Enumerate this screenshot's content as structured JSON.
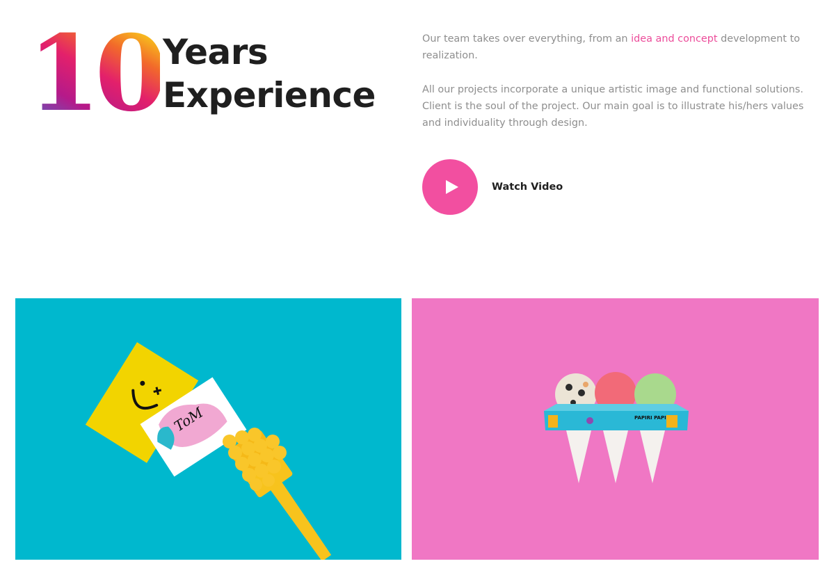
{
  "hero": {
    "number": "10",
    "title_line1": "Years",
    "title_line2": "Experience"
  },
  "intro": {
    "p1_before": "Our team takes over everything, from an ",
    "p1_highlight": "idea and concept",
    "p1_after": " development to realization.",
    "p2": "All our projects incorporate a unique artistic image and functional solutions. Client is the soul of the project. Our main goal is to illustrate his/hers values and individuality through design."
  },
  "video": {
    "label": "Watch Video",
    "icon": "play-icon"
  },
  "portfolio": {
    "tile1_label": "ToM",
    "tile2_label": "PAPIRI PAPIRI"
  },
  "colors": {
    "accent": "#f24fa0",
    "tile1_bg": "#00b8ce",
    "tile2_bg": "#f077c4",
    "heading": "#1f1f1f",
    "body_text": "#8e8e8e"
  }
}
